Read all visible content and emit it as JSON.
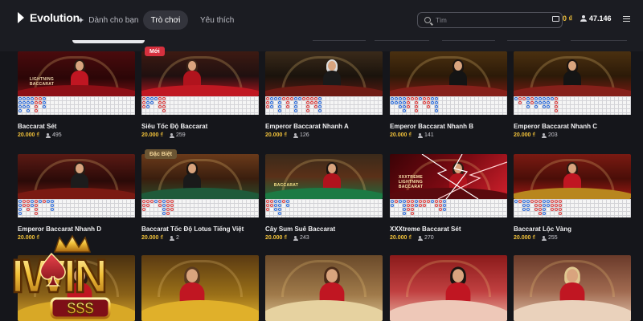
{
  "app": {
    "name": "Evolution"
  },
  "nav": {
    "items": [
      {
        "label": "Dành cho bạn"
      },
      {
        "label": "Trò chơi"
      },
      {
        "label": "Yêu thích"
      }
    ]
  },
  "search": {
    "placeholder": "Tìm"
  },
  "header": {
    "balance": "0 ₫",
    "online": "47.146"
  },
  "colors": {
    "accent": "#f2c23a",
    "badge_new": "#d6303e",
    "badge_special": "#6b5533",
    "background": "#15161b"
  },
  "games": [
    {
      "name": "Baccarat Sét",
      "price": "20.000 ₫",
      "players": "495",
      "badge": "",
      "theme": "red"
    },
    {
      "name": "Siêu Tốc Độ Baccarat",
      "price": "20.000 ₫",
      "players": "259",
      "badge": "Mới",
      "theme": "redtable"
    },
    {
      "name": "Emperor Baccarat Nhanh A",
      "price": "20.000 ₫",
      "players": "126",
      "badge": "",
      "theme": "dark"
    },
    {
      "name": "Emperor Baccarat Nhanh B",
      "price": "20.000 ₫",
      "players": "141",
      "badge": "",
      "theme": "gold"
    },
    {
      "name": "Emperor Baccarat Nhanh C",
      "price": "20.000 ₫",
      "players": "203",
      "badge": "",
      "theme": "gold"
    },
    {
      "name": "Emperor Baccarat Nhanh D",
      "price": "20.000 ₫",
      "players": "",
      "badge": "",
      "theme": "darkred"
    },
    {
      "name": "Baccarat Tốc Độ Lotus Tiếng Việt",
      "price": "20.000 ₫",
      "players": "2",
      "badge": "Đặc Biệt",
      "theme": "wood"
    },
    {
      "name": "Cây Sum Suê Baccarat",
      "price": "20.000 ₫",
      "players": "243",
      "badge": "",
      "theme": "green"
    },
    {
      "name": "XXXtreme Baccarat Sét",
      "price": "20.000 ₫",
      "players": "270",
      "badge": "",
      "theme": "lightning"
    },
    {
      "name": "Baccarat Lộc Vàng",
      "price": "20.000 ₫",
      "players": "255",
      "badge": "",
      "theme": "redgold"
    },
    {
      "name": "",
      "price": "",
      "players": "",
      "badge": "",
      "theme": "yellow"
    },
    {
      "name": "",
      "price": "",
      "players": "",
      "badge": "",
      "theme": "yellow2"
    },
    {
      "name": "",
      "price": "",
      "players": "",
      "badge": "",
      "theme": "beige"
    },
    {
      "name": "",
      "price": "",
      "players": "",
      "badge": "",
      "theme": "pinkred"
    },
    {
      "name": "",
      "price": "",
      "players": "",
      "badge": "",
      "theme": "peach"
    }
  ],
  "thumb_signs": [
    "LIGHTNING BACCARAT",
    "BACCARAT",
    "BACCARAT",
    "XXXTREME LIGHTNING BACCARAT"
  ],
  "watermark": {
    "brand": "IWIN",
    "sub": "$$$"
  }
}
